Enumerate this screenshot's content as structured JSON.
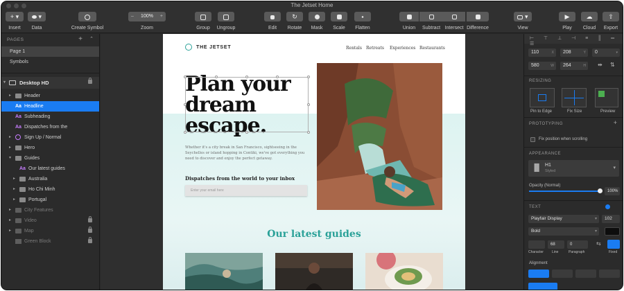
{
  "window": {
    "title": "The Jetset Home"
  },
  "toolbar": {
    "insert": "Insert",
    "data": "Data",
    "create_symbol": "Create Symbol",
    "zoom_value": "100%",
    "zoom": "Zoom",
    "group": "Group",
    "ungroup": "Ungroup",
    "edit": "Edit",
    "rotate": "Rotate",
    "mask": "Mask",
    "scale": "Scale",
    "flatten": "Flatten",
    "union": "Union",
    "subtract": "Subtract",
    "intersect": "Intersect",
    "difference": "Difference",
    "view": "View",
    "play": "Play",
    "cloud": "Cloud",
    "export": "Export"
  },
  "pages": {
    "heading": "PAGES",
    "items": [
      "Page 1",
      "Symbols"
    ]
  },
  "layers": {
    "artboard": "Desktop HD",
    "items": [
      "Header",
      "Headline",
      "Subheading",
      "Dispatches from the",
      "Sign Up / Normal",
      "Hero",
      "Guides",
      "Our latest guides",
      "Australia",
      "Ho Chi Minh",
      "Portugal",
      "City Features",
      "Video",
      "Map",
      "Green Block"
    ]
  },
  "artboard_content": {
    "logo": "THE JETSET",
    "nav": [
      "Rentals",
      "Retreats",
      "Experiences",
      "Restaurants"
    ],
    "headline_lines": [
      "Plan your",
      "dream",
      "escape."
    ],
    "body": "Whether it's a city break in San Francisco, sightseeing in the Seychelles or island hopping in Contiki, we've got everything you need to discover and enjoy the perfect getaway.",
    "dispatch": "Dispatches from the world to your inbox",
    "email_placeholder": "Enter your email here",
    "guides_title": "Our latest guides"
  },
  "inspector": {
    "x": "110",
    "y": "208",
    "rotation": "0",
    "w": "580",
    "h": "264",
    "unit_x": "X",
    "unit_y": "Y",
    "unit_w": "W",
    "unit_h": "H",
    "resizing": "RESIZING",
    "pin_to_edge": "Pin to Edge",
    "fix_size": "Fix Size",
    "preview": "Preview",
    "prototyping": "PROTOTYPING",
    "fix_position": "Fix position when scrolling",
    "appearance": "APPEARANCE",
    "style_name": "H1",
    "style_sub": "Styled",
    "opacity_label": "Opacity (Normal)",
    "opacity_value": "100%",
    "opacity_fraction": 1.0,
    "text": "TEXT",
    "font": "Playfair Display",
    "font_size": "102",
    "weight": "Bold",
    "char_value": "68",
    "para_value": "0",
    "character": "Character",
    "line": "Line",
    "paragraph": "Paragraph",
    "fixed": "Fixed",
    "alignment": "Alignment"
  },
  "colors": {
    "accent": "#1a7cf2",
    "teal": "#2aa198",
    "symbol_text": "#c77dff"
  }
}
